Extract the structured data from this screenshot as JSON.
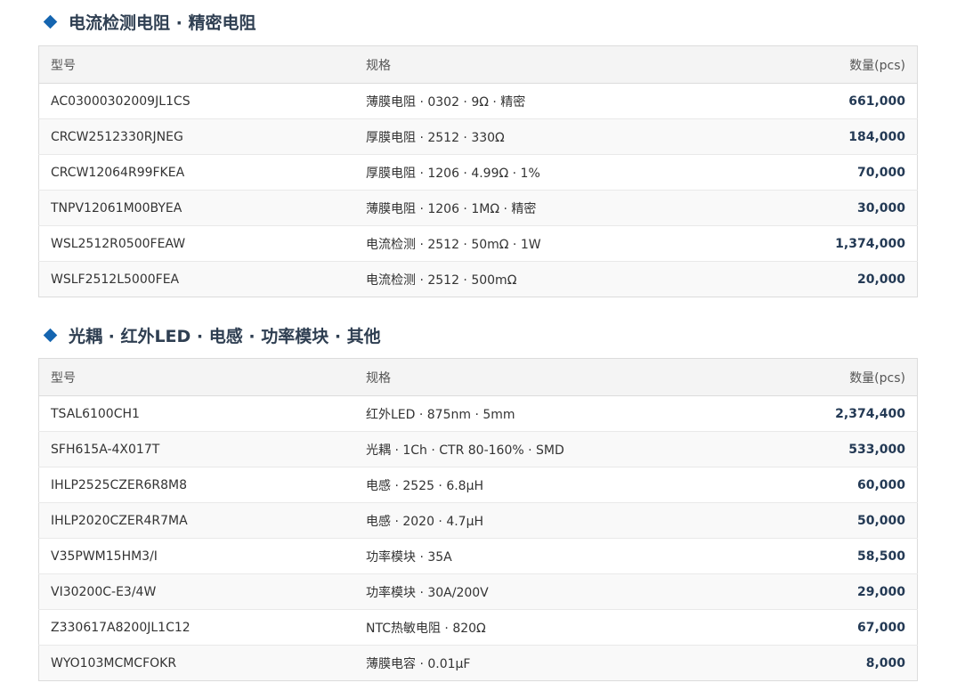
{
  "sections": [
    {
      "title": "电流检测电阻 · 精密电阻",
      "headers": {
        "model": "型号",
        "spec": "规格",
        "qty": "数量(pcs)"
      },
      "rows": [
        {
          "model": "AC03000302009JL1CS",
          "spec": "薄膜电阻 · 0302 · 9Ω · 精密",
          "qty": "661,000"
        },
        {
          "model": "CRCW2512330RJNEG",
          "spec": "厚膜电阻 · 2512 · 330Ω",
          "qty": "184,000"
        },
        {
          "model": "CRCW12064R99FKEA",
          "spec": "厚膜电阻 · 1206 · 4.99Ω · 1%",
          "qty": "70,000"
        },
        {
          "model": "TNPV12061M00BYEA",
          "spec": "薄膜电阻 · 1206 · 1MΩ · 精密",
          "qty": "30,000"
        },
        {
          "model": "WSL2512R0500FEAW",
          "spec": "电流检测 · 2512 · 50mΩ · 1W",
          "qty": "1,374,000"
        },
        {
          "model": "WSLF2512L5000FEA",
          "spec": "电流检测 · 2512 · 500mΩ",
          "qty": "20,000"
        }
      ]
    },
    {
      "title": "光耦 · 红外LED · 电感 · 功率模块 · 其他",
      "headers": {
        "model": "型号",
        "spec": "规格",
        "qty": "数量(pcs)"
      },
      "rows": [
        {
          "model": "TSAL6100CH1",
          "spec": "红外LED · 875nm · 5mm",
          "qty": "2,374,400"
        },
        {
          "model": "SFH615A-4X017T",
          "spec": "光耦 · 1Ch · CTR 80-160% · SMD",
          "qty": "533,000"
        },
        {
          "model": "IHLP2525CZER6R8M8",
          "spec": "电感 · 2525 · 6.8μH",
          "qty": "60,000"
        },
        {
          "model": "IHLP2020CZER4R7MA",
          "spec": "电感 · 2020 · 4.7μH",
          "qty": "50,000"
        },
        {
          "model": "V35PWM15HM3/I",
          "spec": "功率模块 · 35A",
          "qty": "58,500"
        },
        {
          "model": "VI30200C-E3/4W",
          "spec": "功率模块 · 30A/200V",
          "qty": "29,000"
        },
        {
          "model": "Z330617A8200JL1C12",
          "spec": "NTC热敏电阻 · 820Ω",
          "qty": "67,000"
        },
        {
          "model": "WYO103MCMCFOKR",
          "spec": "薄膜电容 · 0.01μF",
          "qty": "8,000"
        }
      ]
    }
  ]
}
